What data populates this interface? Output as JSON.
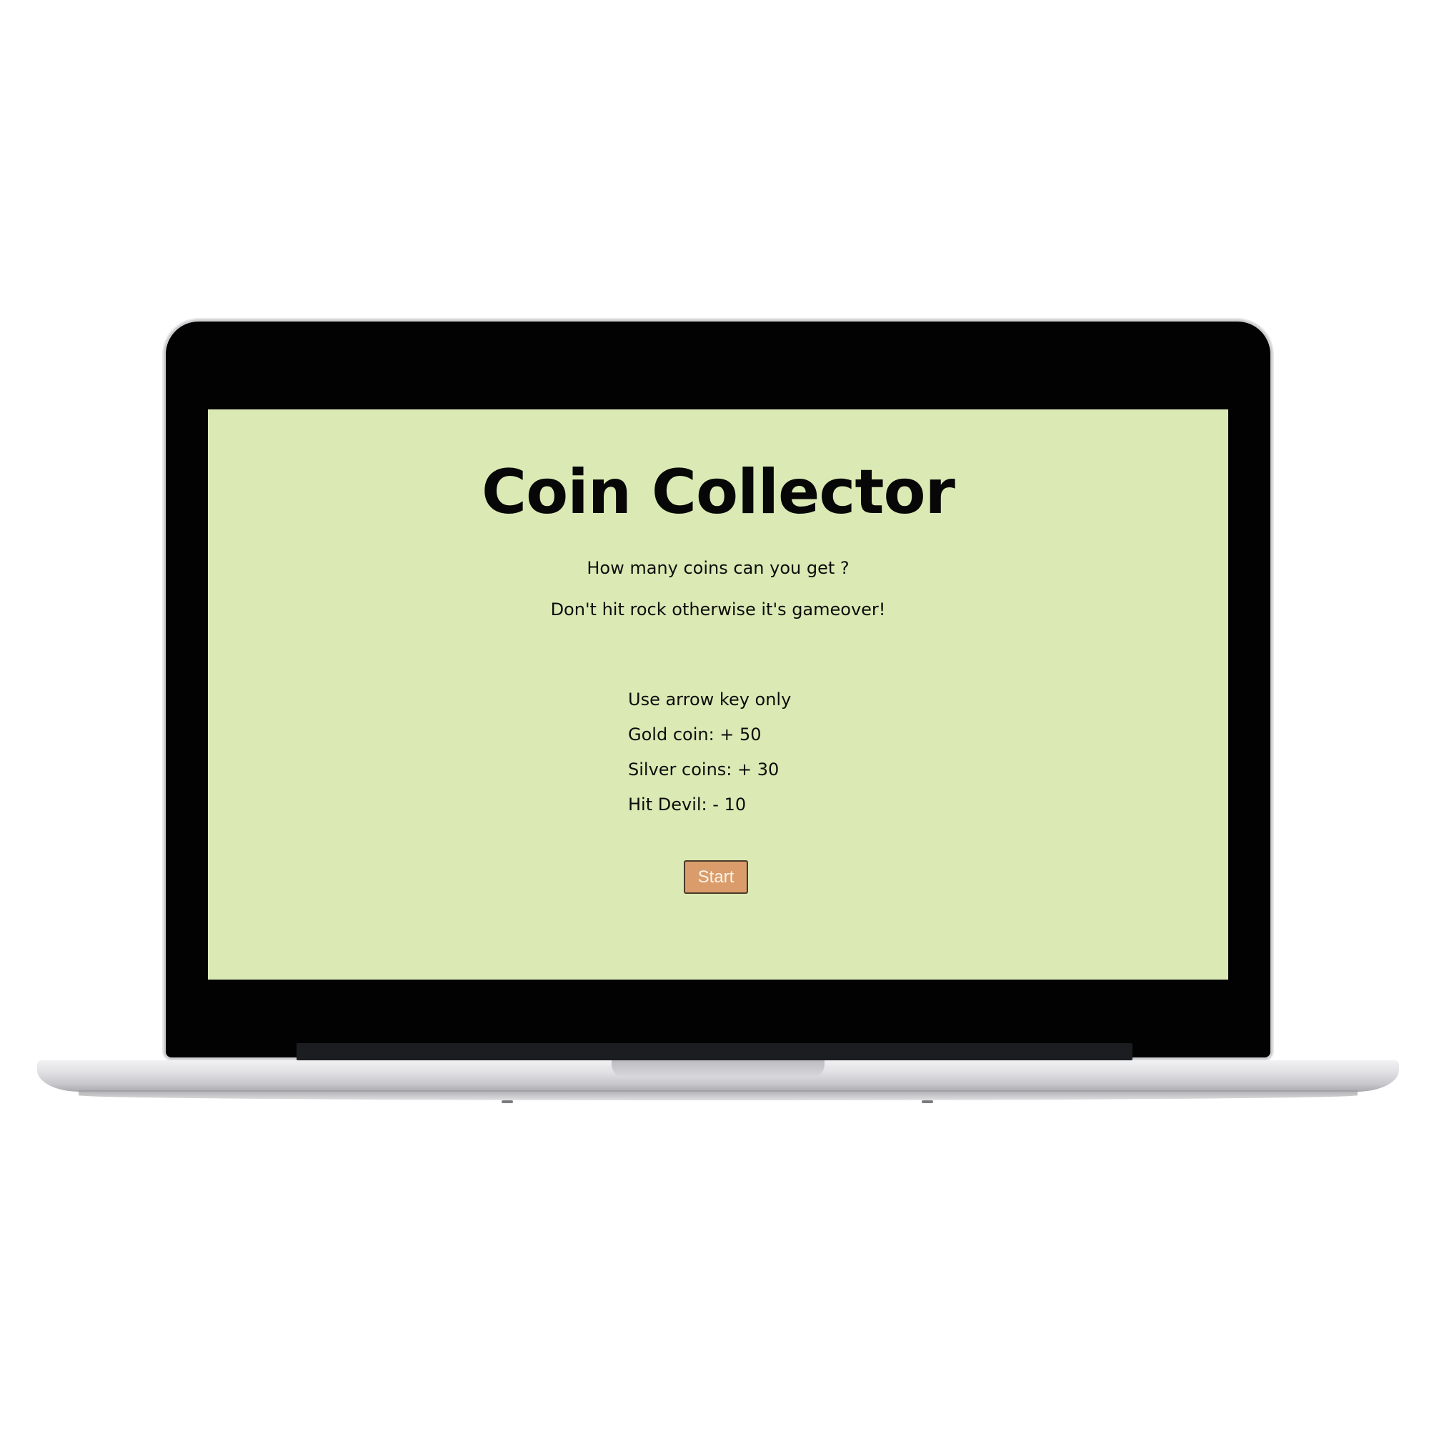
{
  "game": {
    "title": "Coin Collector",
    "tagline": "How many coins can you get ?",
    "warning": "Don't hit rock otherwise it's gameover!",
    "rules": [
      "Use arrow key only",
      "Gold coin: + 50",
      "Silver coins: + 30",
      "Hit Devil: - 10"
    ],
    "start_label": "Start"
  },
  "colors": {
    "screen_background": "#dbeab4",
    "start_button": "#d99c6a",
    "laptop_bezel": "#020203"
  }
}
